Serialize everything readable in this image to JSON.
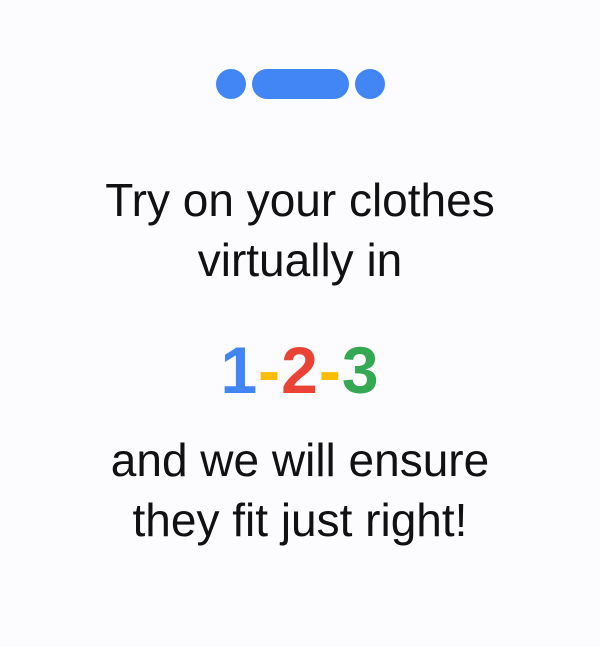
{
  "pager": {
    "dots": 3,
    "active_index": 1,
    "color": "#4285f4"
  },
  "headline": {
    "line1": "Try on your clothes",
    "line2": "virtually in"
  },
  "steps": {
    "one": "1",
    "dash1": "-",
    "two": "2",
    "dash2": "-",
    "three": "3",
    "colors": {
      "one": "#4285f4",
      "dash": "#fbbc05",
      "two": "#ea4335",
      "three": "#34a853"
    }
  },
  "subline": {
    "line1": "and we will ensure",
    "line2": "they fit just right!"
  }
}
